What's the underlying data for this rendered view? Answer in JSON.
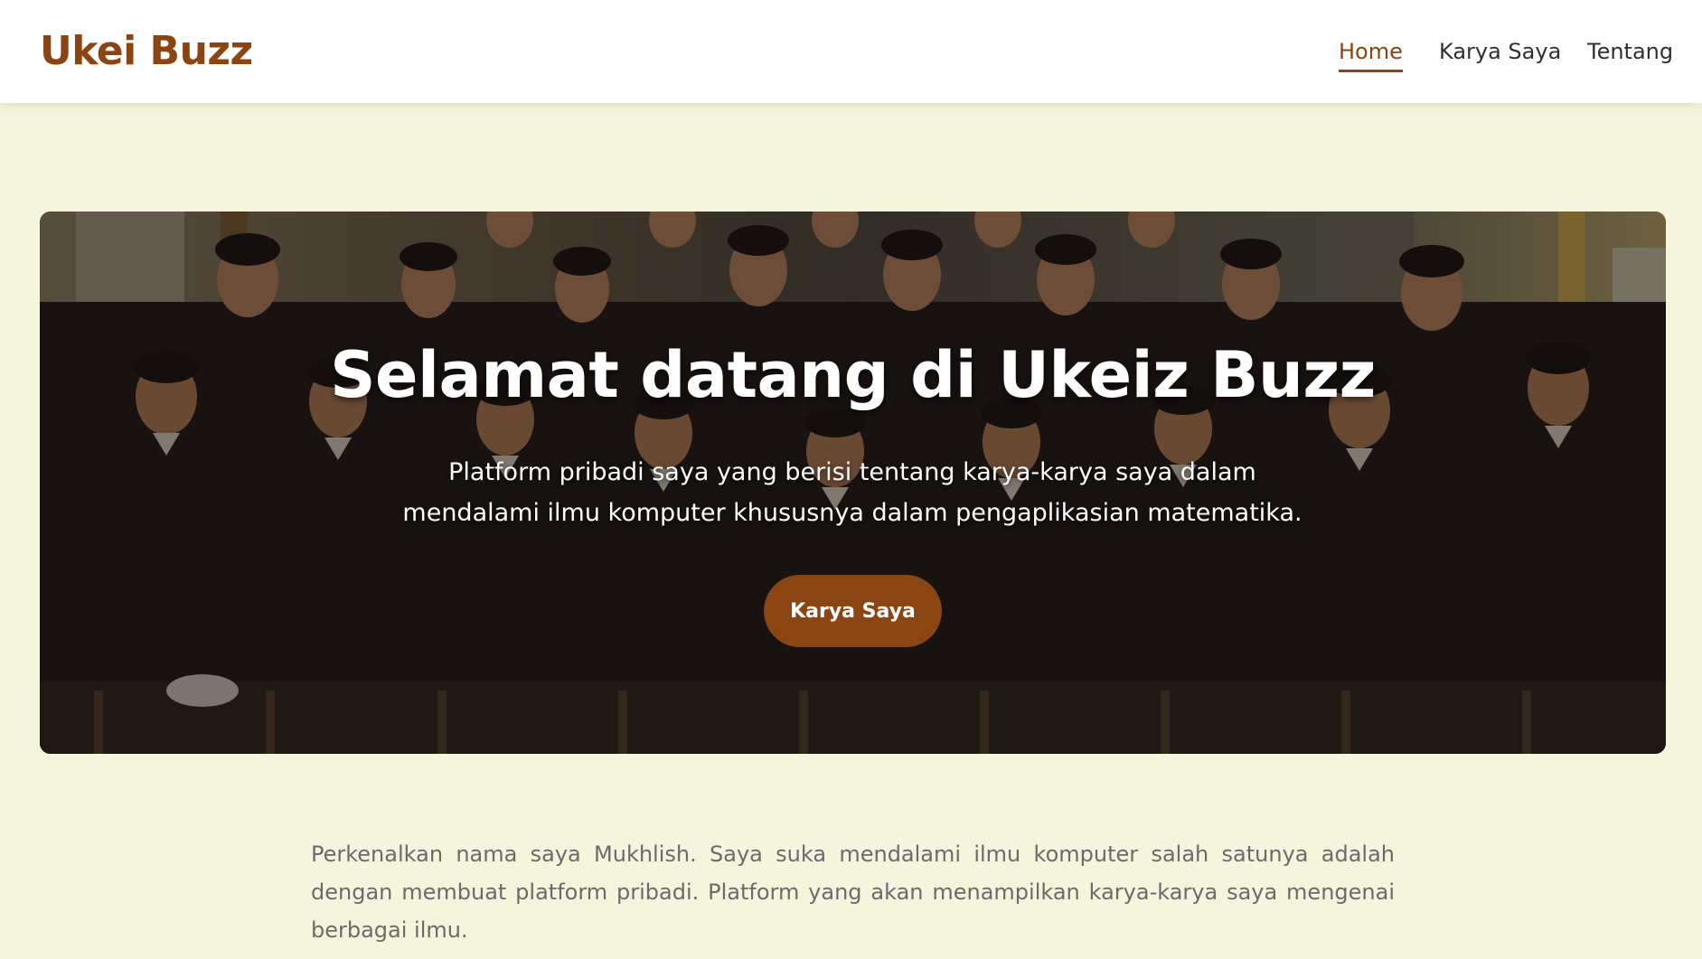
{
  "app": {
    "brand": "Ukei Buzz",
    "accent_color": "#8b4513",
    "background_color": "#f5f4dc"
  },
  "nav": {
    "items": [
      {
        "label": "Home",
        "active": true
      },
      {
        "label": "Karya Saya",
        "active": false
      },
      {
        "label": "Tentang",
        "active": false
      }
    ]
  },
  "hero": {
    "title": "Selamat datang di Ukeiz Buzz",
    "subtitle": "Platform pribadi saya yang berisi tentang karya-karya saya dalam mendalami ilmu komputer khususnya dalam pengaplikasian matematika.",
    "button_label": "Karya Saya",
    "image_subject": "group-photo"
  },
  "intro": {
    "text": "Perkenalkan nama saya Mukhlish. Saya suka mendalami ilmu komputer salah satunya adalah dengan membuat platform pribadi. Platform yang akan menampilkan karya-karya saya mengenai berbagai ilmu."
  }
}
